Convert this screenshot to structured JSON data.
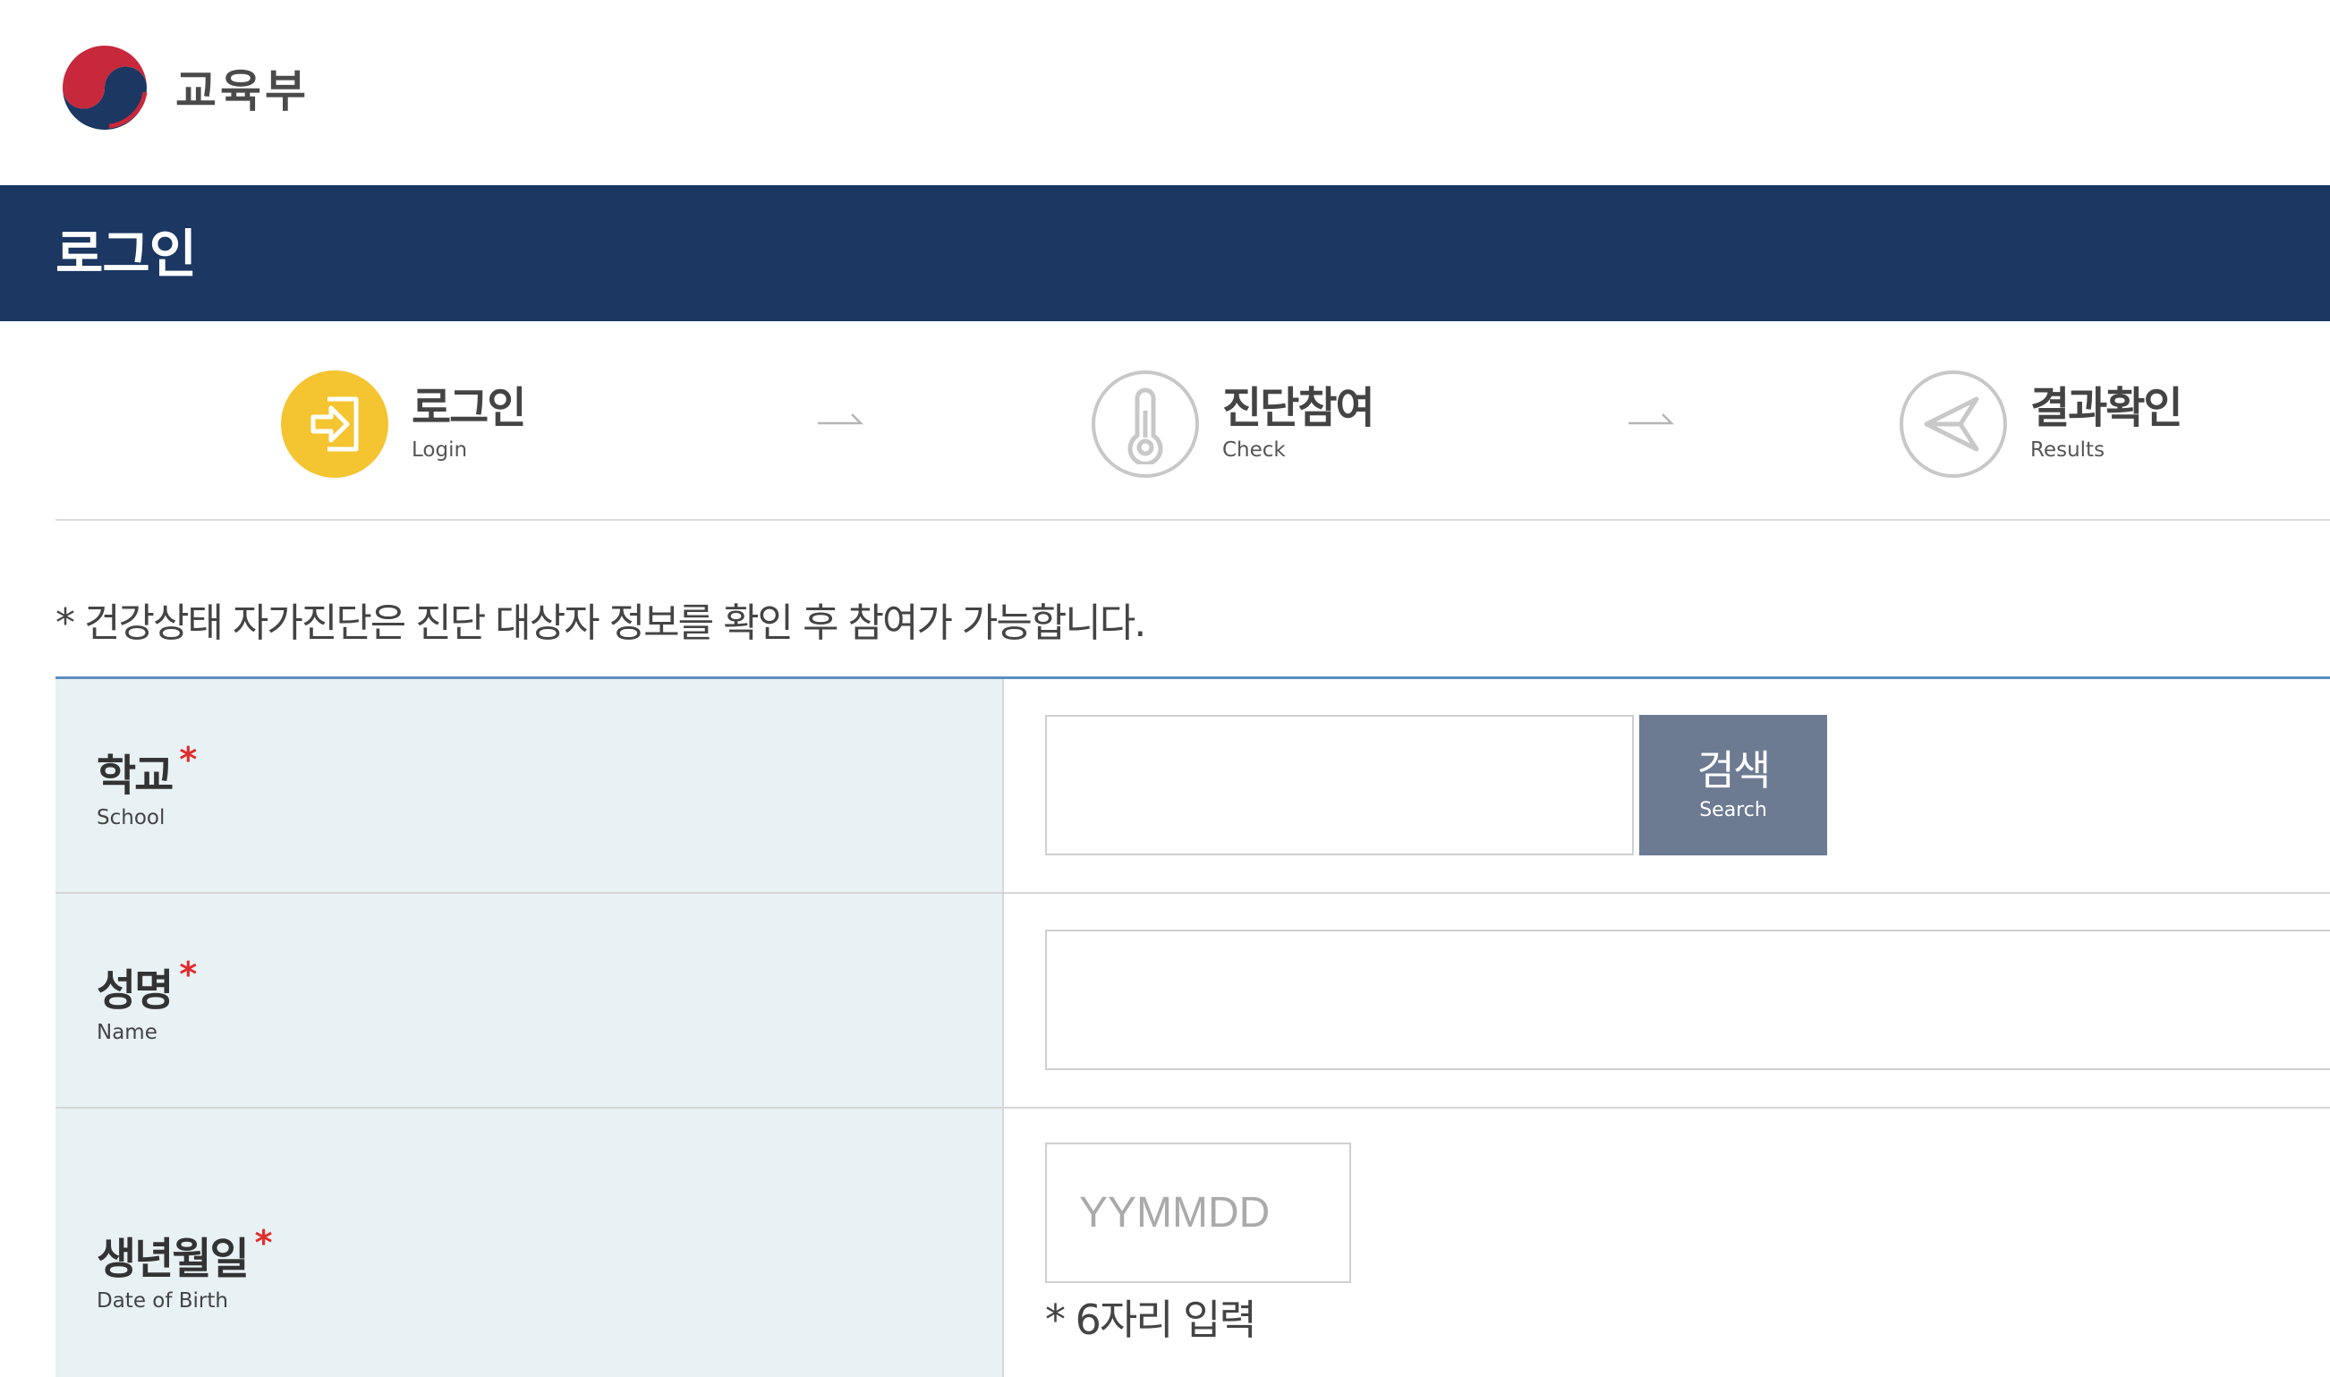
{
  "header": {
    "logo_text": "교육부"
  },
  "title_bar": {
    "title": "로그인"
  },
  "steps": [
    {
      "title": "로그인",
      "subtitle": "Login",
      "icon": "login-arrow-icon",
      "active": true
    },
    {
      "title": "진단참여",
      "subtitle": "Check",
      "icon": "thermometer-icon",
      "active": false
    },
    {
      "title": "결과확인",
      "subtitle": "Results",
      "icon": "paper-plane-icon",
      "active": false
    }
  ],
  "notice": "* 건강상태 자가진단은 진단 대상자 정보를 확인 후 참여가 가능합니다.",
  "form": {
    "school": {
      "label": "학교",
      "required_mark": "*",
      "sublabel": "School",
      "value": "",
      "search_label": "검색",
      "search_sublabel": "Search"
    },
    "name": {
      "label": "성명",
      "required_mark": "*",
      "sublabel": "Name",
      "value": ""
    },
    "birth": {
      "label": "생년월일",
      "required_mark": "*",
      "sublabel": "Date of Birth",
      "value": "",
      "placeholder": "YYMMDD",
      "hint": "* 6자리 입력"
    }
  },
  "colors": {
    "title_bar": "#1b3762",
    "active_step": "#f5c431",
    "inactive_step": "#c8c8c8",
    "label_cell_bg": "#e8f1f4",
    "table_top_border": "#5b8fbf",
    "search_button": "#6c7a92",
    "required": "#e12c2c"
  }
}
